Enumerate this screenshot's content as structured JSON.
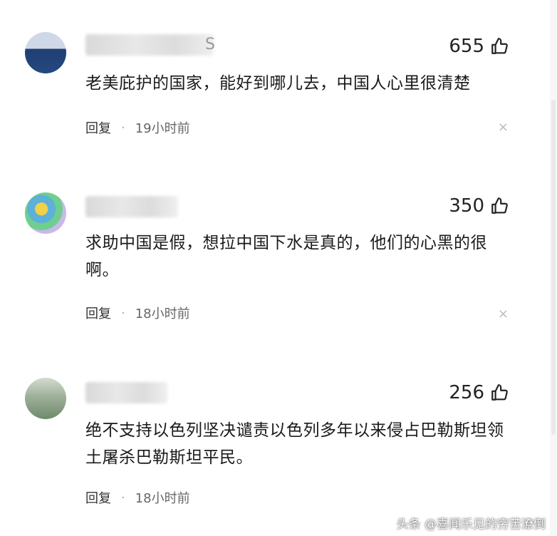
{
  "comments": [
    {
      "username": "S",
      "likes": "655",
      "text": "老美庇护的国家，能好到哪儿去，中国人心里很清楚",
      "reply": "回复",
      "time": "19小时前",
      "close": "×"
    },
    {
      "username": "",
      "likes": "350",
      "text": "求助中国是假，想拉中国下水是真的，他们的心黑的很啊。",
      "reply": "回复",
      "time": "18小时前",
      "close": "×"
    },
    {
      "username": "",
      "likes": "256",
      "text": "绝不支持以色列坚决谴责以色列多年以来侵占巴勒斯坦领土屠杀巴勒斯坦平民。",
      "reply": "回复",
      "time": "18小时前",
      "close": ""
    }
  ],
  "icons": {
    "like": "thumbs-up-icon",
    "close": "close-icon"
  },
  "watermark": "头条 @喜闻乐见的穷苦潦倒"
}
